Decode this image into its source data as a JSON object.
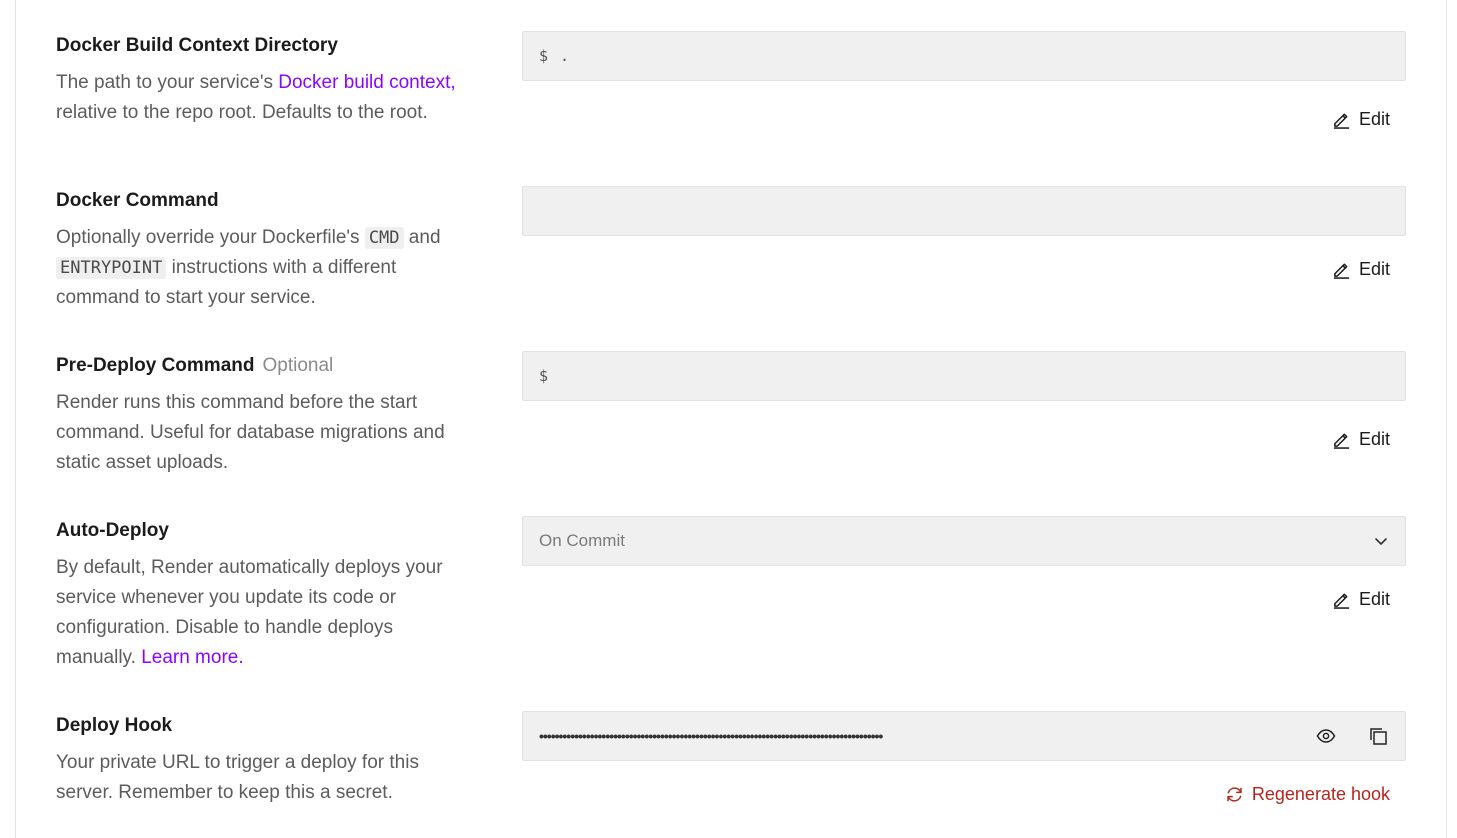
{
  "sections": [
    {
      "title": "Docker Build Context Directory",
      "desc_pre": "The path to your service's ",
      "desc_link": "Docker build context,",
      "desc_post": " relative to the repo root. Defaults to the root.",
      "field_prefix": "$",
      "field_value": ".",
      "action_label": "Edit"
    },
    {
      "title": "Docker Command",
      "desc_part1": "Optionally override your Dockerfile's ",
      "code1": "CMD",
      "desc_part2": " and ",
      "code2": "ENTRYPOINT",
      "desc_part3": " instructions with a different command to start your service.",
      "field_value": "",
      "action_label": "Edit"
    },
    {
      "title": "Pre-Deploy Command",
      "optional_label": "Optional",
      "desc": "Render runs this command before the start command. Useful for database migrations and static asset uploads.",
      "field_prefix": "$",
      "field_value": "",
      "action_label": "Edit"
    },
    {
      "title": "Auto-Deploy",
      "desc_pre": "By default, Render automatically deploys your service whenever you update its code or configuration. Disable to handle deploys manually. ",
      "desc_link": "Learn more.",
      "select_value": "On Commit",
      "action_label": "Edit"
    },
    {
      "title": "Deploy Hook",
      "desc": "Your private URL to trigger a deploy for this server. Remember to keep this a secret.",
      "masked_value": "••••••••••••••••••••••••••••••••••••••••••••••••••••••••••••••••••••••••••••••••••••••••",
      "action_label": "Regenerate hook"
    }
  ],
  "colors": {
    "link": "#8a05ff",
    "danger": "#b3261e",
    "field_bg": "#f0f0f0"
  },
  "icons": [
    "pencil-icon",
    "chevron-down-icon",
    "eye-icon",
    "copy-icon",
    "refresh-icon"
  ]
}
